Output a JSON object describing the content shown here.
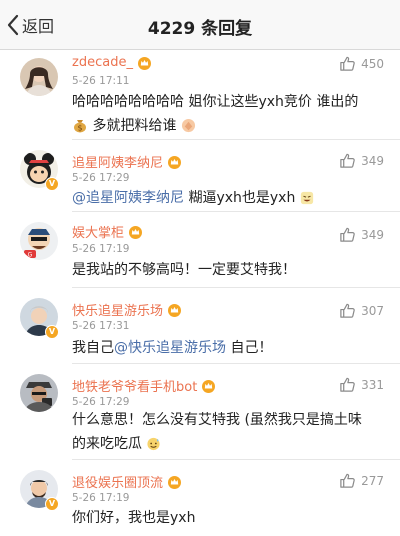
{
  "nav": {
    "back_label": "返回",
    "title": "4229 条回复"
  },
  "colors": {
    "username": "#eb7350",
    "mention": "#4a6ea8",
    "meta": "#999999",
    "badge": "#f5a623"
  },
  "comments": [
    {
      "username": "zdecade_",
      "time": "5-26 17:11",
      "likes": "450",
      "avatar_icon": "avatar-photo-icon",
      "verified": false,
      "line1": "哈哈哈哈哈哈哈哈 姐你让这些yxh竞价 谁出的",
      "line2": "多就把料给谁",
      "emoji_a": "money-bag-emoji",
      "emoji_b": "clap-emoji"
    },
    {
      "username": "追星阿姨李纳尼",
      "time": "5-26 17:29",
      "likes": "349",
      "avatar_icon": "avatar-cartoon-icon",
      "verified": true,
      "mention": "@追星阿姨李纳尼",
      "text": " 糊逼yxh也是yxh",
      "emoji_a": "laugh-emoji"
    },
    {
      "username": "娱大掌柜",
      "time": "5-26 17:19",
      "likes": "349",
      "avatar_icon": "avatar-sticker-icon",
      "verified": false,
      "text": "是我站的不够高吗！一定要艾特我！"
    },
    {
      "username": "快乐追星游乐场",
      "time": "5-26 17:31",
      "likes": "307",
      "avatar_icon": "avatar-photo-icon",
      "verified": true,
      "prefix": "我自己",
      "mention": "@快乐追星游乐场",
      "suffix": " 自己！"
    },
    {
      "username": "地铁老爷爷看手机bot",
      "time": "5-26 17:29",
      "likes": "331",
      "avatar_icon": "avatar-photo-icon",
      "verified": false,
      "line1": "什么意思！怎么没有艾特我 (虽然我只是搞土味",
      "line2": "的来吃吃瓜",
      "emoji_a": "sweat-smile-emoji"
    },
    {
      "username": "退役娱乐圈顶流",
      "time": "5-26 17:19",
      "likes": "277",
      "avatar_icon": "avatar-photo-icon",
      "verified": true,
      "text": "你们好，我也是yxh"
    }
  ]
}
